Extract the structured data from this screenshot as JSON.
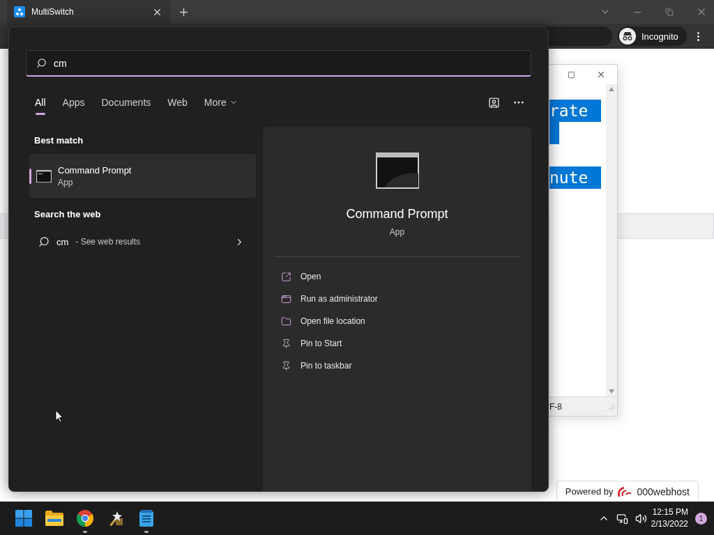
{
  "browser": {
    "tab_title": "MultiSwitch",
    "incognito": "Incognito"
  },
  "notepad": {
    "lines": [
      "rate",
      "nute"
    ],
    "status": "F-8"
  },
  "footer_badge": {
    "prefix": "Powered by",
    "brand": "000webhost"
  },
  "search_panel": {
    "query": "cm",
    "filters": [
      {
        "label": "All",
        "selected": true
      },
      {
        "label": "Apps",
        "selected": false
      },
      {
        "label": "Documents",
        "selected": false
      },
      {
        "label": "Web",
        "selected": false
      },
      {
        "label": "More",
        "selected": false
      }
    ],
    "best_match": {
      "heading": "Best match",
      "name": "Command Prompt",
      "type": "App",
      "selected": true
    },
    "web": {
      "heading": "Search the web",
      "query": "cm",
      "hint": "- See web results"
    },
    "preview": {
      "name": "Command Prompt",
      "type": "App",
      "actions": [
        {
          "label": "Open",
          "kind": "open"
        },
        {
          "label": "Run as administrator",
          "kind": "admin"
        },
        {
          "label": "Open file location",
          "kind": "folder"
        },
        {
          "label": "Pin to Start",
          "kind": "pin"
        },
        {
          "label": "Pin to taskbar",
          "kind": "pin"
        }
      ]
    }
  },
  "taskbar": {
    "apps": [
      {
        "kind": "windows",
        "running": false
      },
      {
        "kind": "folder",
        "running": false
      },
      {
        "kind": "chrome",
        "running": true
      },
      {
        "kind": "tool",
        "running": false
      },
      {
        "kind": "notepad",
        "running": true
      }
    ],
    "time": "12:15 PM",
    "date": "2/13/2022",
    "notifications": "1"
  }
}
